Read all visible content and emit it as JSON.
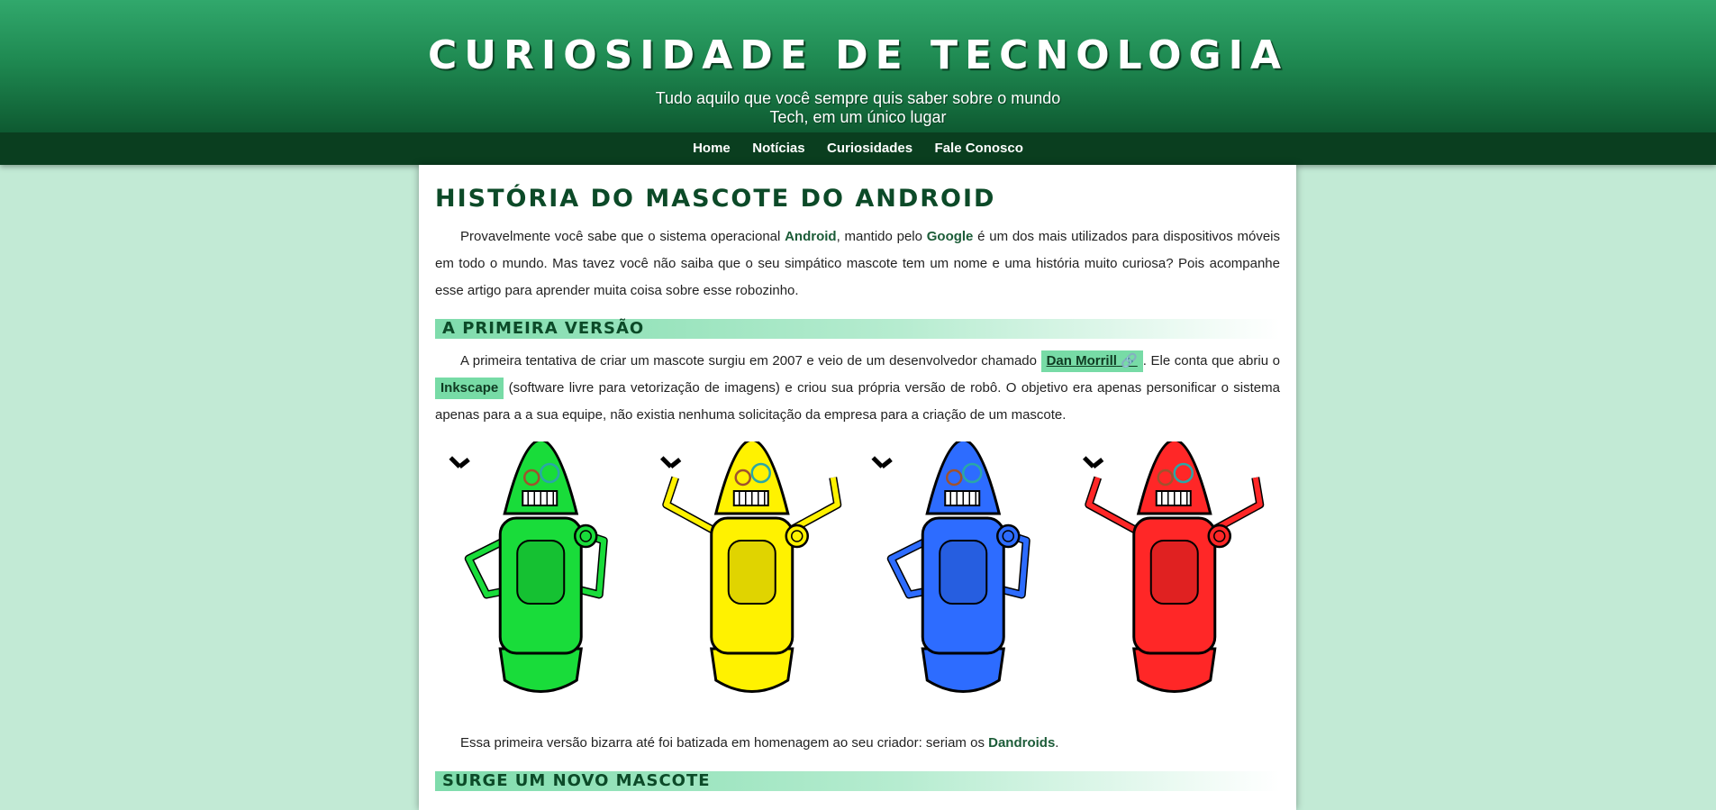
{
  "header": {
    "title": "Curiosidade de Tecnologia",
    "tagline": "Tudo aquilo que você sempre quis saber sobre o mundo Tech, em um único lugar"
  },
  "nav": [
    "Home",
    "Notícias",
    "Curiosidades",
    "Fale Conosco"
  ],
  "article": {
    "title": "História do Mascote do Android",
    "intro": {
      "t1": "Provavelmente você sabe que o sistema operacional ",
      "android": "Android",
      "t2": ", mantido pelo ",
      "google": "Google",
      "t3": " é um dos mais utilizados para dispositivos móveis em todo o mundo. Mas tavez você não saiba que o seu simpático mascote tem um nome e uma história muito curiosa? Pois acompanhe esse artigo para aprender muita coisa sobre esse robozinho."
    },
    "section1": {
      "heading": "A Primeira Versão",
      "p1": {
        "t1": "A primeira tentativa de criar um mascote surgiu em 2007 e veio de um desenvolvedor chamado ",
        "dan": "Dan Morrill",
        "link_icon": "🔗",
        "t2": ". Ele conta que abriu o ",
        "inkscape": "Inkscape",
        "t3": " (software livre para vetorização de imagens) e criou sua própria versão de robô. O objetivo era apenas personificar o sistema apenas para a a sua equipe, não existia nenhuma solicitação da empresa para a criação de um mascote."
      },
      "image": {
        "robot_colors": [
          "#19dc3a",
          "#fff200",
          "#2d6cff",
          "#ff2727"
        ]
      },
      "p2": {
        "t1": "Essa primeira versão bizarra até foi batizada em homenagem ao seu criador: seriam os ",
        "dandroids": "Dandroids",
        "t2": "."
      }
    },
    "section2": {
      "heading": "Surge um novo mascote"
    }
  },
  "colors": {
    "header_top": "#31a86c",
    "header_bottom": "#0e5a31",
    "nav_bg": "#0a3e1f",
    "page_bg": "#c2ead5",
    "heading": "#0c4a28",
    "highlight": "#77dba6"
  }
}
